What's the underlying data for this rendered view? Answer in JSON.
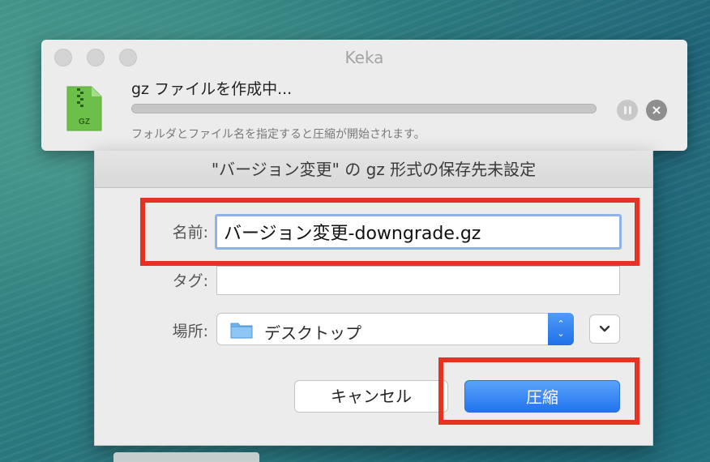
{
  "keka": {
    "window_title": "Keka",
    "file_type_label": "GZ",
    "task_title": "gz ファイルを作成中...",
    "status_text": "フォルダとファイル名を指定すると圧縮が開始されます。",
    "progress_fraction": 0
  },
  "sheet": {
    "title": "\"バージョン変更\" の gz 形式の保存先未設定",
    "name_label": "名前:",
    "name_value": "バージョン変更-downgrade.gz",
    "tag_label": "タグ:",
    "tag_value": "",
    "where_label": "場所:",
    "where_value": "デスクトップ",
    "stepper_up": "⌃",
    "stepper_down": "⌄",
    "cancel_label": "キャンセル",
    "compress_label": "圧縮"
  },
  "colors": {
    "highlight": "#e53223",
    "accent": "#2174ee",
    "file_icon": "#6cc04a"
  }
}
